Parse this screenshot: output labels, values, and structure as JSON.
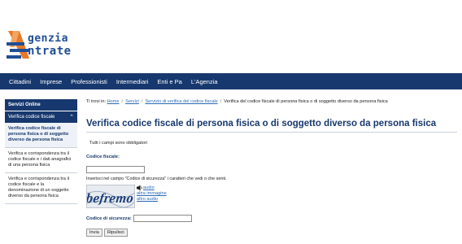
{
  "logo": {
    "line1": "genzia",
    "line2": "ntrate"
  },
  "nav": [
    "Cittadini",
    "Imprese",
    "Professionisti",
    "Intermediari",
    "Enti e Pa",
    "L'Agenzia"
  ],
  "sidebar": {
    "heading": "Servizi Online",
    "section": "Verifica codice fiscale",
    "section_icon": "chevron-up-icon",
    "items": [
      "Verifica codice fiscale di persona fisica o di soggetto diverso da persona fisica",
      "Verifica e corrispondenza tra il codice fiscale e i dati anagrafici di una persona fisica",
      "Verifica e corrispondenza tra il codice fiscale e la denominazione di un soggetto diverso da persona fisica"
    ]
  },
  "breadcrumb": {
    "prefix": "Ti trovi in:",
    "links": [
      "Home",
      "Servizi",
      "Servizio di verifica del codice fiscale"
    ],
    "current": "Verifica del codice fiscale di persona fisica o di soggetto diverso da persona fisica"
  },
  "page_title": "Verifica codice fiscale di persona fisica o di soggetto diverso da persona fisica",
  "form": {
    "required_note": "Tutti i campi sono obbligatori",
    "cf_label": "Codice fiscale:",
    "cf_value": "",
    "instructions": "Inserisci nel campo \"Codice di sicurezza\" i caratteri che vedi o che senti.",
    "captcha_text": "befremo",
    "audio_link": "audio",
    "other_image_link": "altra immagine",
    "other_audio_link": "altro audio",
    "security_label": "Codice di sicurezza:",
    "security_value": "",
    "submit_label": "Invia",
    "reset_label": "Ripulisci"
  },
  "colors": {
    "brand": "#17386e",
    "link": "#2a6ab7",
    "logo_orange": "#e8782a"
  }
}
